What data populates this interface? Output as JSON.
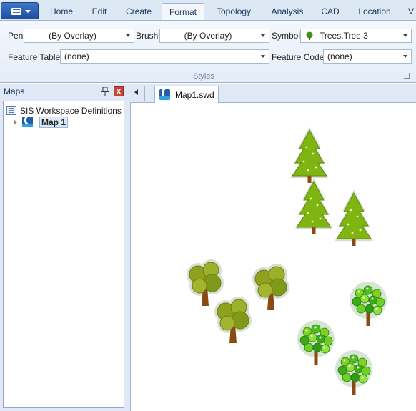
{
  "ribbon": {
    "tabs": [
      "Home",
      "Edit",
      "Create",
      "Format",
      "Topology",
      "Analysis",
      "CAD",
      "Location",
      "V"
    ],
    "active_tab": "Format",
    "pen_label": "Pen",
    "pen_value": "(By Overlay)",
    "brush_label": "Brush",
    "brush_value": "(By Overlay)",
    "symbol_label": "Symbol",
    "symbol_value": "Trees.Tree 3",
    "feature_table_label": "Feature Table",
    "feature_table_value": "(none)",
    "feature_code_label": "Feature Code",
    "feature_code_value": "(none)",
    "group_label": "Styles"
  },
  "maps_pane": {
    "title": "Maps",
    "close_glyph": "x",
    "root_label": "SIS Workspace Definitions",
    "map_item": "Map 1"
  },
  "document": {
    "tab_label": "Map1.swd"
  },
  "map_symbols": {
    "conifer_count": 3,
    "broadleaf_count": 3,
    "fruit_tree_count": 3
  },
  "colors": {
    "accent": "#1f5ea8",
    "ribbon_bg": "#e4edf8",
    "conifer_green": "#7fb511",
    "trunk_brown": "#8b4a12",
    "fruit_green": "#2fb11c"
  }
}
